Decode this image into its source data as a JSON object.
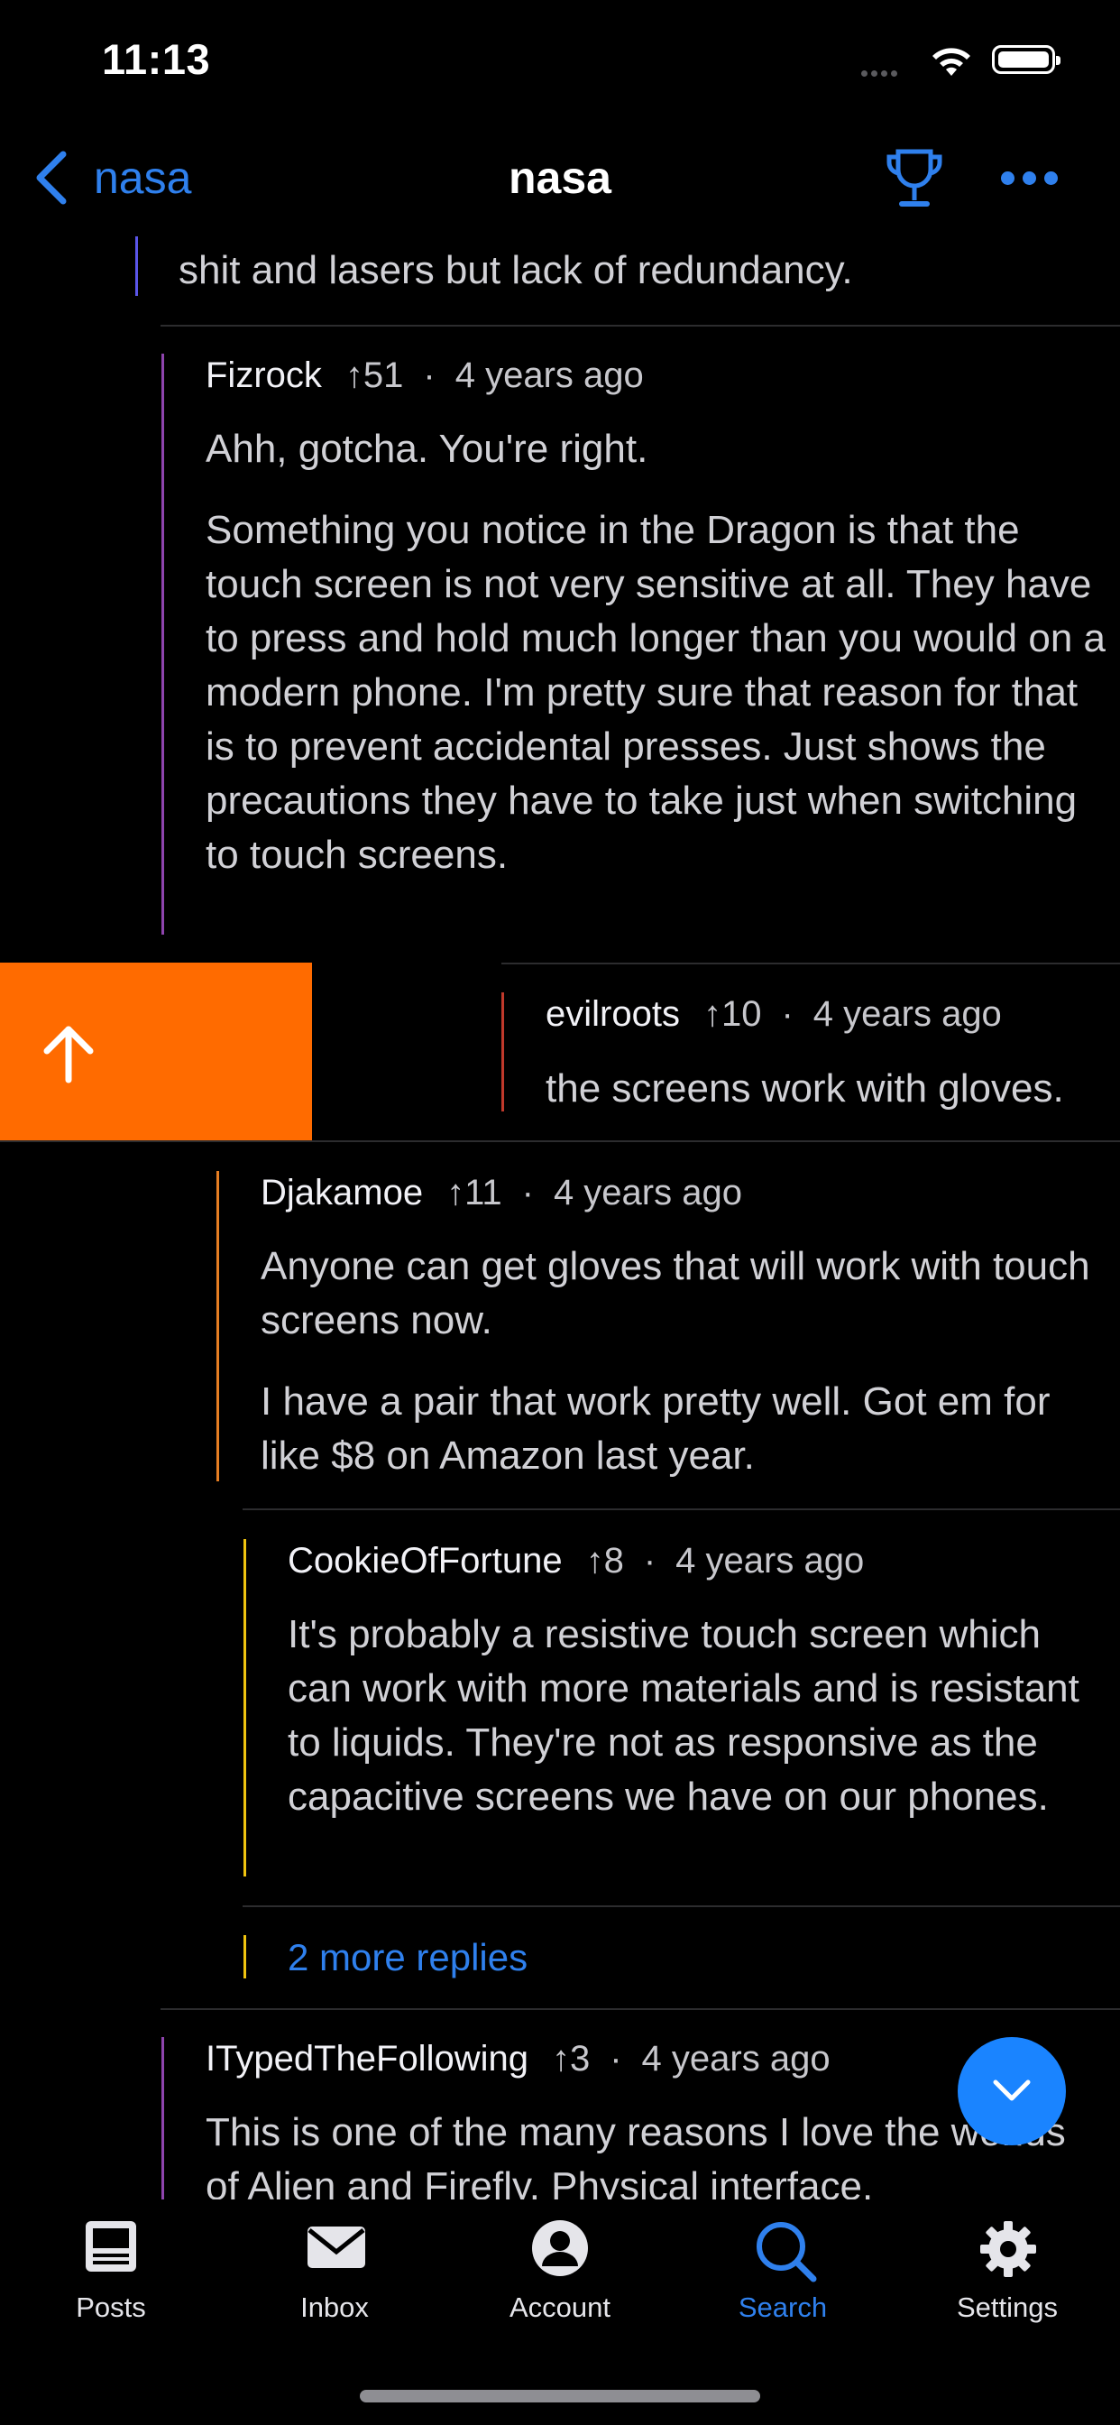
{
  "status_bar": {
    "time": "11:13"
  },
  "nav": {
    "back_label": "nasa",
    "title": "nasa"
  },
  "comments": [
    {
      "id": "c0",
      "text_partial": "shit and lasers but lack of redundancy."
    },
    {
      "id": "c1",
      "author": "Fizrock",
      "score": "51",
      "age": "4 years ago",
      "paragraphs": [
        "Ahh, gotcha. You're right.",
        "Something you notice in the Dragon is that the touch screen is not very sensitive at all. They have to press and hold much longer than you would on a modern phone. I'm pretty sure that reason for that is to prevent accidental presses. Just shows the precautions they have to take just when switching to touch screens."
      ]
    },
    {
      "id": "c2",
      "author": "evilroots",
      "score": "10",
      "age": "4 years ago",
      "paragraphs": [
        "the screens work with gloves."
      ]
    },
    {
      "id": "c3",
      "author": "Djakamoe",
      "score": "11",
      "age": "4 years ago",
      "paragraphs": [
        "Anyone can get gloves that will work with touch screens now.",
        "I have a pair that work pretty well. Got em for like $8 on Amazon last year."
      ]
    },
    {
      "id": "c4",
      "author": "CookieOfFortune",
      "score": "8",
      "age": "4 years ago",
      "paragraphs": [
        "It's probably a resistive touch screen which can work with more materials and is resistant to liquids. They're not as responsive as the capacitive screens we have on our phones."
      ]
    },
    {
      "id": "c5",
      "more_replies": "2 more replies"
    },
    {
      "id": "c6",
      "author": "ITypedTheFollowing",
      "score": "3",
      "age": "4 years ago",
      "paragraphs": [
        "This is one of the many reasons I love the worlds of Alien and Firefly. Physical interface."
      ]
    }
  ],
  "meta_separator": "·",
  "score_arrow": "↑",
  "swipe_action": {
    "icon": "upvote-arrow-icon",
    "color": "#ff6b00"
  },
  "fab": {
    "icon": "chevron-down-icon",
    "color": "#1a84ff"
  },
  "tabs": [
    {
      "label": "Posts",
      "icon": "posts-icon",
      "active": false
    },
    {
      "label": "Inbox",
      "icon": "envelope-icon",
      "active": false
    },
    {
      "label": "Account",
      "icon": "person-icon",
      "active": false
    },
    {
      "label": "Search",
      "icon": "search-icon",
      "active": true
    },
    {
      "label": "Settings",
      "icon": "gear-icon",
      "active": false
    }
  ],
  "colors": {
    "accent": "#2f80ed",
    "background": "#000000",
    "active_tab": "#2f80ed"
  }
}
